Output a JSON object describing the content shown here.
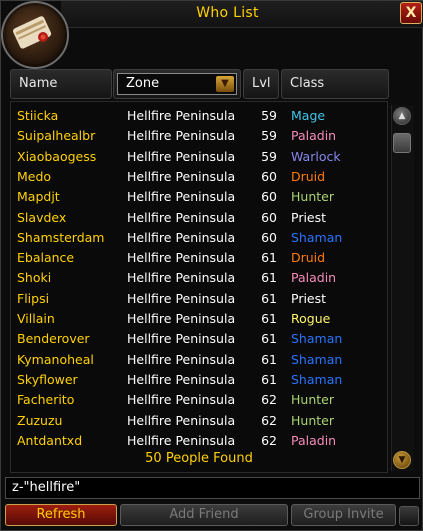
{
  "window": {
    "title": "Who List",
    "close_label": "X"
  },
  "columns": {
    "name": "Name",
    "zone": "Zone",
    "level": "Lvl",
    "class": "Class"
  },
  "class_colors": {
    "Mage": "#40c7eb",
    "Paladin": "#f58cba",
    "Warlock": "#8787ed",
    "Druid": "#ff7d0a",
    "Hunter": "#abd473",
    "Priest": "#ffffff",
    "Shaman": "#2b73ff",
    "Rogue": "#fff569"
  },
  "rows": [
    {
      "name": "Stiicka",
      "zone": "Hellfire Peninsula",
      "level": "59",
      "class": "Mage"
    },
    {
      "name": "Suipalhealbr",
      "zone": "Hellfire Peninsula",
      "level": "59",
      "class": "Paladin"
    },
    {
      "name": "Xiaobaogess",
      "zone": "Hellfire Peninsula",
      "level": "59",
      "class": "Warlock"
    },
    {
      "name": "Medo",
      "zone": "Hellfire Peninsula",
      "level": "60",
      "class": "Druid"
    },
    {
      "name": "Mapdjt",
      "zone": "Hellfire Peninsula",
      "level": "60",
      "class": "Hunter"
    },
    {
      "name": "Slavdex",
      "zone": "Hellfire Peninsula",
      "level": "60",
      "class": "Priest"
    },
    {
      "name": "Shamsterdam",
      "zone": "Hellfire Peninsula",
      "level": "60",
      "class": "Shaman"
    },
    {
      "name": "Ebalance",
      "zone": "Hellfire Peninsula",
      "level": "61",
      "class": "Druid"
    },
    {
      "name": "Shoki",
      "zone": "Hellfire Peninsula",
      "level": "61",
      "class": "Paladin"
    },
    {
      "name": "Flipsi",
      "zone": "Hellfire Peninsula",
      "level": "61",
      "class": "Priest"
    },
    {
      "name": "Villain",
      "zone": "Hellfire Peninsula",
      "level": "61",
      "class": "Rogue"
    },
    {
      "name": "Benderover",
      "zone": "Hellfire Peninsula",
      "level": "61",
      "class": "Shaman"
    },
    {
      "name": "Kymanoheal",
      "zone": "Hellfire Peninsula",
      "level": "61",
      "class": "Shaman"
    },
    {
      "name": "Skyflower",
      "zone": "Hellfire Peninsula",
      "level": "61",
      "class": "Shaman"
    },
    {
      "name": "Facherito",
      "zone": "Hellfire Peninsula",
      "level": "62",
      "class": "Hunter"
    },
    {
      "name": "Zuzuzu",
      "zone": "Hellfire Peninsula",
      "level": "62",
      "class": "Hunter"
    },
    {
      "name": "Antdantxd",
      "zone": "Hellfire Peninsula",
      "level": "62",
      "class": "Paladin"
    }
  ],
  "status": {
    "found": "50 People Found"
  },
  "command": {
    "value": "z-\"hellfire\""
  },
  "buttons": {
    "refresh": "Refresh",
    "add_friend": "Add Friend",
    "group_invite": "Group Invite"
  }
}
